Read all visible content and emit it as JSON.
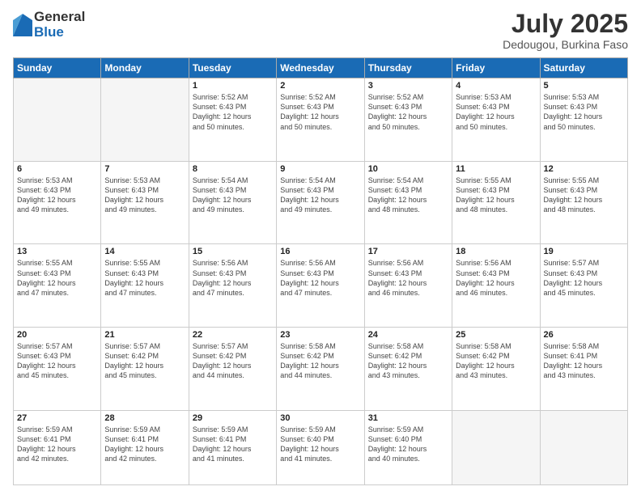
{
  "logo": {
    "general": "General",
    "blue": "Blue"
  },
  "title": "July 2025",
  "location": "Dedougou, Burkina Faso",
  "weekdays": [
    "Sunday",
    "Monday",
    "Tuesday",
    "Wednesday",
    "Thursday",
    "Friday",
    "Saturday"
  ],
  "weeks": [
    [
      {
        "day": "",
        "info": ""
      },
      {
        "day": "",
        "info": ""
      },
      {
        "day": "1",
        "sunrise": "5:52 AM",
        "sunset": "6:43 PM",
        "daylight": "12 hours and 50 minutes."
      },
      {
        "day": "2",
        "sunrise": "5:52 AM",
        "sunset": "6:43 PM",
        "daylight": "12 hours and 50 minutes."
      },
      {
        "day": "3",
        "sunrise": "5:52 AM",
        "sunset": "6:43 PM",
        "daylight": "12 hours and 50 minutes."
      },
      {
        "day": "4",
        "sunrise": "5:53 AM",
        "sunset": "6:43 PM",
        "daylight": "12 hours and 50 minutes."
      },
      {
        "day": "5",
        "sunrise": "5:53 AM",
        "sunset": "6:43 PM",
        "daylight": "12 hours and 50 minutes."
      }
    ],
    [
      {
        "day": "6",
        "sunrise": "5:53 AM",
        "sunset": "6:43 PM",
        "daylight": "12 hours and 49 minutes."
      },
      {
        "day": "7",
        "sunrise": "5:53 AM",
        "sunset": "6:43 PM",
        "daylight": "12 hours and 49 minutes."
      },
      {
        "day": "8",
        "sunrise": "5:54 AM",
        "sunset": "6:43 PM",
        "daylight": "12 hours and 49 minutes."
      },
      {
        "day": "9",
        "sunrise": "5:54 AM",
        "sunset": "6:43 PM",
        "daylight": "12 hours and 49 minutes."
      },
      {
        "day": "10",
        "sunrise": "5:54 AM",
        "sunset": "6:43 PM",
        "daylight": "12 hours and 48 minutes."
      },
      {
        "day": "11",
        "sunrise": "5:55 AM",
        "sunset": "6:43 PM",
        "daylight": "12 hours and 48 minutes."
      },
      {
        "day": "12",
        "sunrise": "5:55 AM",
        "sunset": "6:43 PM",
        "daylight": "12 hours and 48 minutes."
      }
    ],
    [
      {
        "day": "13",
        "sunrise": "5:55 AM",
        "sunset": "6:43 PM",
        "daylight": "12 hours and 47 minutes."
      },
      {
        "day": "14",
        "sunrise": "5:55 AM",
        "sunset": "6:43 PM",
        "daylight": "12 hours and 47 minutes."
      },
      {
        "day": "15",
        "sunrise": "5:56 AM",
        "sunset": "6:43 PM",
        "daylight": "12 hours and 47 minutes."
      },
      {
        "day": "16",
        "sunrise": "5:56 AM",
        "sunset": "6:43 PM",
        "daylight": "12 hours and 47 minutes."
      },
      {
        "day": "17",
        "sunrise": "5:56 AM",
        "sunset": "6:43 PM",
        "daylight": "12 hours and 46 minutes."
      },
      {
        "day": "18",
        "sunrise": "5:56 AM",
        "sunset": "6:43 PM",
        "daylight": "12 hours and 46 minutes."
      },
      {
        "day": "19",
        "sunrise": "5:57 AM",
        "sunset": "6:43 PM",
        "daylight": "12 hours and 45 minutes."
      }
    ],
    [
      {
        "day": "20",
        "sunrise": "5:57 AM",
        "sunset": "6:43 PM",
        "daylight": "12 hours and 45 minutes."
      },
      {
        "day": "21",
        "sunrise": "5:57 AM",
        "sunset": "6:42 PM",
        "daylight": "12 hours and 45 minutes."
      },
      {
        "day": "22",
        "sunrise": "5:57 AM",
        "sunset": "6:42 PM",
        "daylight": "12 hours and 44 minutes."
      },
      {
        "day": "23",
        "sunrise": "5:58 AM",
        "sunset": "6:42 PM",
        "daylight": "12 hours and 44 minutes."
      },
      {
        "day": "24",
        "sunrise": "5:58 AM",
        "sunset": "6:42 PM",
        "daylight": "12 hours and 43 minutes."
      },
      {
        "day": "25",
        "sunrise": "5:58 AM",
        "sunset": "6:42 PM",
        "daylight": "12 hours and 43 minutes."
      },
      {
        "day": "26",
        "sunrise": "5:58 AM",
        "sunset": "6:41 PM",
        "daylight": "12 hours and 43 minutes."
      }
    ],
    [
      {
        "day": "27",
        "sunrise": "5:59 AM",
        "sunset": "6:41 PM",
        "daylight": "12 hours and 42 minutes."
      },
      {
        "day": "28",
        "sunrise": "5:59 AM",
        "sunset": "6:41 PM",
        "daylight": "12 hours and 42 minutes."
      },
      {
        "day": "29",
        "sunrise": "5:59 AM",
        "sunset": "6:41 PM",
        "daylight": "12 hours and 41 minutes."
      },
      {
        "day": "30",
        "sunrise": "5:59 AM",
        "sunset": "6:40 PM",
        "daylight": "12 hours and 41 minutes."
      },
      {
        "day": "31",
        "sunrise": "5:59 AM",
        "sunset": "6:40 PM",
        "daylight": "12 hours and 40 minutes."
      },
      {
        "day": "",
        "info": ""
      },
      {
        "day": "",
        "info": ""
      }
    ]
  ],
  "labels": {
    "sunrise": "Sunrise:",
    "sunset": "Sunset:",
    "daylight": "Daylight:"
  }
}
